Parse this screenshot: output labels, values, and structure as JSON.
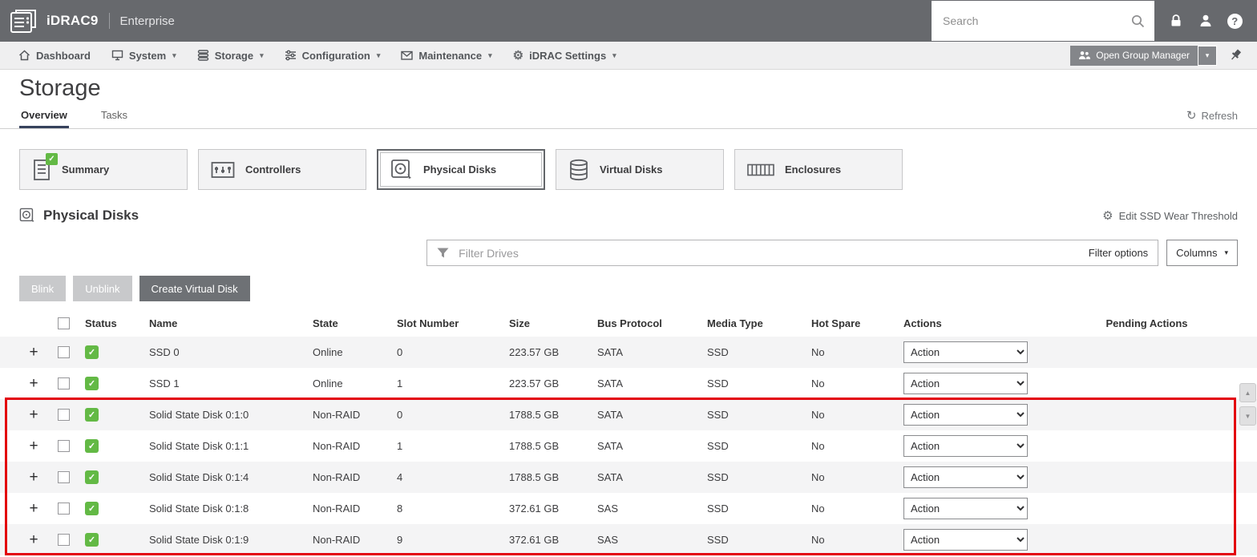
{
  "colors": {
    "status_green": "#63b945",
    "annotation_red": "#e3000e",
    "topbar_gray": "#67696d"
  },
  "glyphs": {
    "caret": "▾",
    "gear": "⚙",
    "plus": "+",
    "check": "✓",
    "refresh": "↻",
    "question": "?",
    "up": "▲",
    "down": "▼"
  },
  "header": {
    "brand": "iDRAC9",
    "edition": "Enterprise",
    "search_placeholder": "Search"
  },
  "nav": {
    "items": [
      {
        "label": "Dashboard"
      },
      {
        "label": "System"
      },
      {
        "label": "Storage"
      },
      {
        "label": "Configuration"
      },
      {
        "label": "Maintenance"
      },
      {
        "label": "iDRAC Settings"
      }
    ],
    "open_group_manager": "Open Group Manager"
  },
  "page": {
    "title": "Storage",
    "tab_overview": "Overview",
    "tab_tasks": "Tasks",
    "refresh": "Refresh"
  },
  "cards": {
    "summary": "Summary",
    "controllers": "Controllers",
    "physical_disks": "Physical Disks",
    "virtual_disks": "Virtual Disks",
    "enclosures": "Enclosures"
  },
  "section": {
    "title": "Physical Disks",
    "edit_ssd": "Edit SSD Wear Threshold"
  },
  "filter": {
    "placeholder": "Filter Drives",
    "options": "Filter options",
    "columns": "Columns"
  },
  "toolbar": {
    "blink": "Blink",
    "unblink": "Unblink",
    "create_virtual_disk": "Create Virtual Disk"
  },
  "table": {
    "action_label": "Action",
    "headers": {
      "status": "Status",
      "name": "Name",
      "state": "State",
      "slot": "Slot Number",
      "size": "Size",
      "bus": "Bus Protocol",
      "media": "Media Type",
      "hot_spare": "Hot Spare",
      "actions": "Actions",
      "pending": "Pending Actions"
    },
    "rows": [
      {
        "name": "SSD 0",
        "state": "Online",
        "slot": "0",
        "size": "223.57 GB",
        "bus": "SATA",
        "media": "SSD",
        "hot_spare": "No"
      },
      {
        "name": "SSD 1",
        "state": "Online",
        "slot": "1",
        "size": "223.57 GB",
        "bus": "SATA",
        "media": "SSD",
        "hot_spare": "No"
      },
      {
        "name": "Solid State Disk 0:1:0",
        "state": "Non-RAID",
        "slot": "0",
        "size": "1788.5 GB",
        "bus": "SATA",
        "media": "SSD",
        "hot_spare": "No"
      },
      {
        "name": "Solid State Disk 0:1:1",
        "state": "Non-RAID",
        "slot": "1",
        "size": "1788.5 GB",
        "bus": "SATA",
        "media": "SSD",
        "hot_spare": "No"
      },
      {
        "name": "Solid State Disk 0:1:4",
        "state": "Non-RAID",
        "slot": "4",
        "size": "1788.5 GB",
        "bus": "SATA",
        "media": "SSD",
        "hot_spare": "No"
      },
      {
        "name": "Solid State Disk 0:1:8",
        "state": "Non-RAID",
        "slot": "8",
        "size": "372.61 GB",
        "bus": "SAS",
        "media": "SSD",
        "hot_spare": "No"
      },
      {
        "name": "Solid State Disk 0:1:9",
        "state": "Non-RAID",
        "slot": "9",
        "size": "372.61 GB",
        "bus": "SAS",
        "media": "SSD",
        "hot_spare": "No"
      }
    ]
  }
}
